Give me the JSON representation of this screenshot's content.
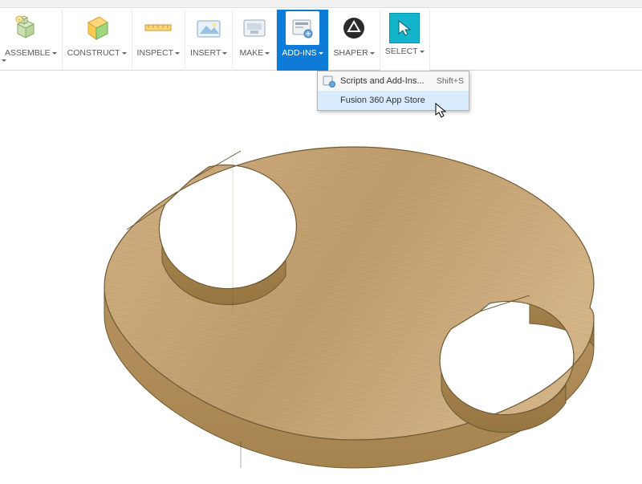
{
  "toolbar": {
    "assemble": "ASSEMBLE",
    "construct": "CONSTRUCT",
    "inspect": "INSPECT",
    "insert": "INSERT",
    "make": "MAKE",
    "addins": "ADD-INS",
    "shaper": "SHAPER",
    "select": "SELECT"
  },
  "dropdown": {
    "scripts_label": "Scripts and Add-Ins...",
    "scripts_shortcut": "Shift+S",
    "appstore_label": "Fusion 360 App Store"
  },
  "model": {
    "description": "Oval wooden plate with two circular cutouts, extruded solid",
    "material": "wood-oak",
    "approx_color_top": "#c6a574",
    "approx_color_side": "#b08e5f"
  }
}
